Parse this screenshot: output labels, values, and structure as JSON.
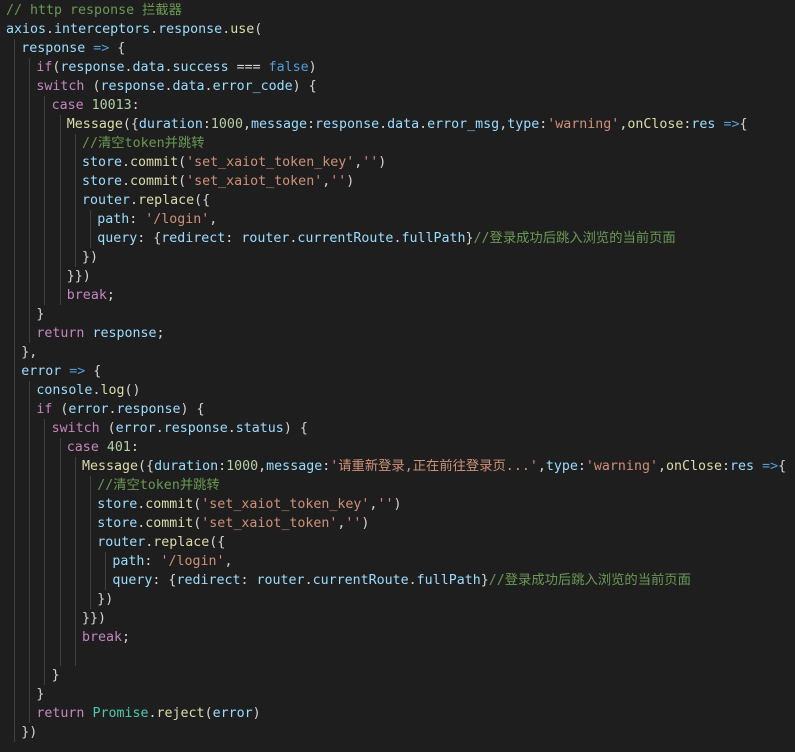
{
  "editor": {
    "language": "javascript",
    "lines": [
      {
        "indent": 0,
        "tokens": [
          {
            "t": "// http response 拦截器",
            "c": "cm"
          }
        ]
      },
      {
        "indent": 0,
        "tokens": [
          {
            "t": "axios",
            "c": "vr"
          },
          {
            "t": ".",
            "c": "pn"
          },
          {
            "t": "interceptors",
            "c": "vr"
          },
          {
            "t": ".",
            "c": "pn"
          },
          {
            "t": "response",
            "c": "vr"
          },
          {
            "t": ".",
            "c": "pn"
          },
          {
            "t": "use",
            "c": "fn"
          },
          {
            "t": "(",
            "c": "pn"
          }
        ]
      },
      {
        "indent": 1,
        "tokens": [
          {
            "t": "response",
            "c": "vr"
          },
          {
            "t": " ",
            "c": "pn"
          },
          {
            "t": "=>",
            "c": "st"
          },
          {
            "t": " {",
            "c": "pn"
          }
        ]
      },
      {
        "indent": 2,
        "tokens": [
          {
            "t": "if",
            "c": "kw"
          },
          {
            "t": "(",
            "c": "pn"
          },
          {
            "t": "response",
            "c": "vr"
          },
          {
            "t": ".",
            "c": "pn"
          },
          {
            "t": "data",
            "c": "vr"
          },
          {
            "t": ".",
            "c": "pn"
          },
          {
            "t": "success",
            "c": "vr"
          },
          {
            "t": " === ",
            "c": "pn"
          },
          {
            "t": "false",
            "c": "st"
          },
          {
            "t": ")",
            "c": "pn"
          }
        ]
      },
      {
        "indent": 2,
        "tokens": [
          {
            "t": "switch",
            "c": "kw"
          },
          {
            "t": " (",
            "c": "pn"
          },
          {
            "t": "response",
            "c": "vr"
          },
          {
            "t": ".",
            "c": "pn"
          },
          {
            "t": "data",
            "c": "vr"
          },
          {
            "t": ".",
            "c": "pn"
          },
          {
            "t": "error_code",
            "c": "vr"
          },
          {
            "t": ") {",
            "c": "pn"
          }
        ]
      },
      {
        "indent": 3,
        "tokens": [
          {
            "t": "case",
            "c": "kw"
          },
          {
            "t": " ",
            "c": "pn"
          },
          {
            "t": "10013",
            "c": "nu"
          },
          {
            "t": ":",
            "c": "pn"
          }
        ]
      },
      {
        "indent": 4,
        "tokens": [
          {
            "t": "Message",
            "c": "fn"
          },
          {
            "t": "({",
            "c": "pn"
          },
          {
            "t": "duration",
            "c": "vr"
          },
          {
            "t": ":",
            "c": "pn"
          },
          {
            "t": "1000",
            "c": "nu"
          },
          {
            "t": ",",
            "c": "pn"
          },
          {
            "t": "message",
            "c": "vr"
          },
          {
            "t": ":",
            "c": "pn"
          },
          {
            "t": "response",
            "c": "vr"
          },
          {
            "t": ".",
            "c": "pn"
          },
          {
            "t": "data",
            "c": "vr"
          },
          {
            "t": ".",
            "c": "pn"
          },
          {
            "t": "error_msg",
            "c": "vr"
          },
          {
            "t": ",",
            "c": "pn"
          },
          {
            "t": "type",
            "c": "vr"
          },
          {
            "t": ":",
            "c": "pn"
          },
          {
            "t": "'warning'",
            "c": "st2"
          },
          {
            "t": ",",
            "c": "pn"
          },
          {
            "t": "onClose",
            "c": "fn"
          },
          {
            "t": ":",
            "c": "pn"
          },
          {
            "t": "res",
            "c": "vr"
          },
          {
            "t": " ",
            "c": "pn"
          },
          {
            "t": "=>",
            "c": "st"
          },
          {
            "t": "{",
            "c": "pn"
          }
        ]
      },
      {
        "indent": 5,
        "tokens": [
          {
            "t": "//清空token并跳转",
            "c": "cm"
          }
        ]
      },
      {
        "indent": 5,
        "tokens": [
          {
            "t": "store",
            "c": "vr"
          },
          {
            "t": ".",
            "c": "pn"
          },
          {
            "t": "commit",
            "c": "fn"
          },
          {
            "t": "(",
            "c": "pn"
          },
          {
            "t": "'set_xaiot_token_key'",
            "c": "st2"
          },
          {
            "t": ",",
            "c": "pn"
          },
          {
            "t": "''",
            "c": "st2"
          },
          {
            "t": ")",
            "c": "pn"
          }
        ]
      },
      {
        "indent": 5,
        "tokens": [
          {
            "t": "store",
            "c": "vr"
          },
          {
            "t": ".",
            "c": "pn"
          },
          {
            "t": "commit",
            "c": "fn"
          },
          {
            "t": "(",
            "c": "pn"
          },
          {
            "t": "'set_xaiot_token'",
            "c": "st2"
          },
          {
            "t": ",",
            "c": "pn"
          },
          {
            "t": "''",
            "c": "st2"
          },
          {
            "t": ")",
            "c": "pn"
          }
        ]
      },
      {
        "indent": 5,
        "tokens": [
          {
            "t": "router",
            "c": "vr"
          },
          {
            "t": ".",
            "c": "pn"
          },
          {
            "t": "replace",
            "c": "fn"
          },
          {
            "t": "({",
            "c": "pn"
          }
        ]
      },
      {
        "indent": 6,
        "tokens": [
          {
            "t": "path",
            "c": "vr"
          },
          {
            "t": ": ",
            "c": "pn"
          },
          {
            "t": "'/login'",
            "c": "st2"
          },
          {
            "t": ",",
            "c": "pn"
          }
        ]
      },
      {
        "indent": 6,
        "tokens": [
          {
            "t": "query",
            "c": "vr"
          },
          {
            "t": ": {",
            "c": "pn"
          },
          {
            "t": "redirect",
            "c": "vr"
          },
          {
            "t": ": ",
            "c": "pn"
          },
          {
            "t": "router",
            "c": "vr"
          },
          {
            "t": ".",
            "c": "pn"
          },
          {
            "t": "currentRoute",
            "c": "vr"
          },
          {
            "t": ".",
            "c": "pn"
          },
          {
            "t": "fullPath",
            "c": "vr"
          },
          {
            "t": "}",
            "c": "pn"
          },
          {
            "t": "//登录成功后跳入浏览的当前页面",
            "c": "cm"
          }
        ]
      },
      {
        "indent": 5,
        "tokens": [
          {
            "t": "})",
            "c": "pn"
          }
        ]
      },
      {
        "indent": 4,
        "tokens": [
          {
            "t": "}})",
            "c": "pn"
          }
        ]
      },
      {
        "indent": 4,
        "tokens": [
          {
            "t": "break",
            "c": "kw"
          },
          {
            "t": ";",
            "c": "pn"
          }
        ]
      },
      {
        "indent": 2,
        "tokens": [
          {
            "t": "}",
            "c": "pn"
          }
        ]
      },
      {
        "indent": 2,
        "tokens": [
          {
            "t": "return",
            "c": "kw"
          },
          {
            "t": " ",
            "c": "pn"
          },
          {
            "t": "response",
            "c": "vr"
          },
          {
            "t": ";",
            "c": "pn"
          }
        ]
      },
      {
        "indent": 1,
        "tokens": [
          {
            "t": "},",
            "c": "pn"
          }
        ]
      },
      {
        "indent": 1,
        "tokens": [
          {
            "t": "error",
            "c": "vr"
          },
          {
            "t": " ",
            "c": "pn"
          },
          {
            "t": "=>",
            "c": "st"
          },
          {
            "t": " {",
            "c": "pn"
          }
        ]
      },
      {
        "indent": 2,
        "tokens": [
          {
            "t": "console",
            "c": "vr"
          },
          {
            "t": ".",
            "c": "pn"
          },
          {
            "t": "log",
            "c": "fn"
          },
          {
            "t": "()",
            "c": "pn"
          }
        ]
      },
      {
        "indent": 2,
        "tokens": [
          {
            "t": "if",
            "c": "kw"
          },
          {
            "t": " (",
            "c": "pn"
          },
          {
            "t": "error",
            "c": "vr"
          },
          {
            "t": ".",
            "c": "pn"
          },
          {
            "t": "response",
            "c": "vr"
          },
          {
            "t": ") {",
            "c": "pn"
          }
        ]
      },
      {
        "indent": 3,
        "tokens": [
          {
            "t": "switch",
            "c": "kw"
          },
          {
            "t": " (",
            "c": "pn"
          },
          {
            "t": "error",
            "c": "vr"
          },
          {
            "t": ".",
            "c": "pn"
          },
          {
            "t": "response",
            "c": "vr"
          },
          {
            "t": ".",
            "c": "pn"
          },
          {
            "t": "status",
            "c": "vr"
          },
          {
            "t": ") {",
            "c": "pn"
          }
        ]
      },
      {
        "indent": 4,
        "tokens": [
          {
            "t": "case",
            "c": "kw"
          },
          {
            "t": " ",
            "c": "pn"
          },
          {
            "t": "401",
            "c": "nu"
          },
          {
            "t": ":",
            "c": "pn"
          }
        ]
      },
      {
        "indent": 5,
        "tokens": [
          {
            "t": "Message",
            "c": "fn"
          },
          {
            "t": "({",
            "c": "pn"
          },
          {
            "t": "duration",
            "c": "vr"
          },
          {
            "t": ":",
            "c": "pn"
          },
          {
            "t": "1000",
            "c": "nu"
          },
          {
            "t": ",",
            "c": "pn"
          },
          {
            "t": "message",
            "c": "vr"
          },
          {
            "t": ":",
            "c": "pn"
          },
          {
            "t": "'请重新登录,正在前往登录页...'",
            "c": "st2"
          },
          {
            "t": ",",
            "c": "pn"
          },
          {
            "t": "type",
            "c": "vr"
          },
          {
            "t": ":",
            "c": "pn"
          },
          {
            "t": "'warning'",
            "c": "st2"
          },
          {
            "t": ",",
            "c": "pn"
          },
          {
            "t": "onClose",
            "c": "fn"
          },
          {
            "t": ":",
            "c": "pn"
          },
          {
            "t": "res",
            "c": "vr"
          },
          {
            "t": " ",
            "c": "pn"
          },
          {
            "t": "=>",
            "c": "st"
          },
          {
            "t": "{",
            "c": "pn"
          }
        ]
      },
      {
        "indent": 6,
        "tokens": [
          {
            "t": "//清空token并跳转",
            "c": "cm"
          }
        ]
      },
      {
        "indent": 6,
        "tokens": [
          {
            "t": "store",
            "c": "vr"
          },
          {
            "t": ".",
            "c": "pn"
          },
          {
            "t": "commit",
            "c": "fn"
          },
          {
            "t": "(",
            "c": "pn"
          },
          {
            "t": "'set_xaiot_token_key'",
            "c": "st2"
          },
          {
            "t": ",",
            "c": "pn"
          },
          {
            "t": "''",
            "c": "st2"
          },
          {
            "t": ")",
            "c": "pn"
          }
        ]
      },
      {
        "indent": 6,
        "tokens": [
          {
            "t": "store",
            "c": "vr"
          },
          {
            "t": ".",
            "c": "pn"
          },
          {
            "t": "commit",
            "c": "fn"
          },
          {
            "t": "(",
            "c": "pn"
          },
          {
            "t": "'set_xaiot_token'",
            "c": "st2"
          },
          {
            "t": ",",
            "c": "pn"
          },
          {
            "t": "''",
            "c": "st2"
          },
          {
            "t": ")",
            "c": "pn"
          }
        ]
      },
      {
        "indent": 6,
        "tokens": [
          {
            "t": "router",
            "c": "vr"
          },
          {
            "t": ".",
            "c": "pn"
          },
          {
            "t": "replace",
            "c": "fn"
          },
          {
            "t": "({",
            "c": "pn"
          }
        ]
      },
      {
        "indent": 7,
        "tokens": [
          {
            "t": "path",
            "c": "vr"
          },
          {
            "t": ": ",
            "c": "pn"
          },
          {
            "t": "'/login'",
            "c": "st2"
          },
          {
            "t": ",",
            "c": "pn"
          }
        ]
      },
      {
        "indent": 7,
        "tokens": [
          {
            "t": "query",
            "c": "vr"
          },
          {
            "t": ": {",
            "c": "pn"
          },
          {
            "t": "redirect",
            "c": "vr"
          },
          {
            "t": ": ",
            "c": "pn"
          },
          {
            "t": "router",
            "c": "vr"
          },
          {
            "t": ".",
            "c": "pn"
          },
          {
            "t": "currentRoute",
            "c": "vr"
          },
          {
            "t": ".",
            "c": "pn"
          },
          {
            "t": "fullPath",
            "c": "vr"
          },
          {
            "t": "}",
            "c": "pn"
          },
          {
            "t": "//登录成功后跳入浏览的当前页面",
            "c": "cm"
          }
        ]
      },
      {
        "indent": 6,
        "tokens": [
          {
            "t": "})",
            "c": "pn"
          }
        ]
      },
      {
        "indent": 5,
        "tokens": [
          {
            "t": "}})",
            "c": "pn"
          }
        ]
      },
      {
        "indent": 5,
        "tokens": [
          {
            "t": "break",
            "c": "kw"
          },
          {
            "t": ";",
            "c": "pn"
          }
        ]
      },
      {
        "indent": 5,
        "tokens": []
      },
      {
        "indent": 3,
        "tokens": [
          {
            "t": "}",
            "c": "pn"
          }
        ]
      },
      {
        "indent": 2,
        "tokens": [
          {
            "t": "}",
            "c": "pn"
          }
        ]
      },
      {
        "indent": 2,
        "tokens": [
          {
            "t": "return",
            "c": "kw"
          },
          {
            "t": " ",
            "c": "pn"
          },
          {
            "t": "Promise",
            "c": "cls"
          },
          {
            "t": ".",
            "c": "pn"
          },
          {
            "t": "reject",
            "c": "fn"
          },
          {
            "t": "(",
            "c": "pn"
          },
          {
            "t": "error",
            "c": "vr"
          },
          {
            "t": ")",
            "c": "pn"
          }
        ]
      },
      {
        "indent": 1,
        "tokens": [
          {
            "t": "})",
            "c": "pn"
          }
        ]
      }
    ]
  }
}
